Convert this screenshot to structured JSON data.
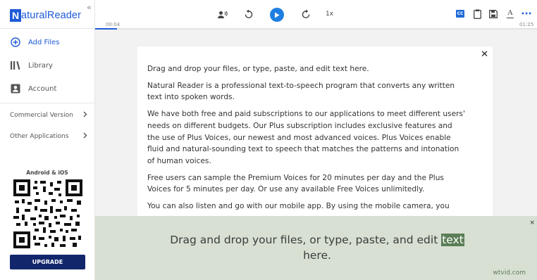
{
  "app": {
    "logo_letter": "N",
    "logo_text": "aturalReader",
    "collapse_glyph": "«",
    "brand_color": "#1f5bd8"
  },
  "sidebar": {
    "nav": [
      {
        "label": "Add Files",
        "icon": "add-circle-icon",
        "active": true
      },
      {
        "label": "Library",
        "icon": "library-icon",
        "active": false
      },
      {
        "label": "Account",
        "icon": "account-icon",
        "active": false
      }
    ],
    "menus": [
      {
        "label": "Commercial Version",
        "icon": "chevron-right-icon"
      },
      {
        "label": "Other Applications",
        "icon": "chevron-right-icon"
      }
    ],
    "platform_label": "Android & iOS",
    "upgrade_label": "UPGRADE"
  },
  "player": {
    "time_current": "00:04",
    "time_total": "01:25",
    "progress_fraction": 0.05,
    "speed_label": "1x",
    "icons": [
      "voice-icon",
      "rewind-icon",
      "play-icon",
      "forward-icon",
      "caption-icon",
      "clipboard-icon",
      "save-icon",
      "text-format-icon",
      "more-icon"
    ],
    "caption_label": "CC",
    "text_format_label": "A",
    "more_label": "•••"
  },
  "document": {
    "close_glyph": "✕",
    "paragraphs": [
      "Drag and drop your files, or type, paste, and edit text here.",
      "Natural Reader is a professional text-to-speech program that converts any written text into spoken words.",
      "We have both free and paid subscriptions to our applications to meet different users' needs on different budgets. Our Plus subscription includes exclusive features and the use of Plus Voices, our newest and most advanced voices. Plus Voices enable fluid and natural-sounding text to speech that matches the patterns and intonation of human voices.",
      "Free users can sample the Premium Voices for 20 minutes per day and the Plus Voices for 5 minutes per day. Or use any available Free Voices unlimitedly.",
      "You can also listen and go with our mobile app. By using the mobile camera, you"
    ]
  },
  "reader": {
    "text_before": "Drag and drop your files, or type, paste, and edit ",
    "highlight": "text",
    "text_after": " here.",
    "close_glyph": "×"
  },
  "watermark": "wtvid.com"
}
